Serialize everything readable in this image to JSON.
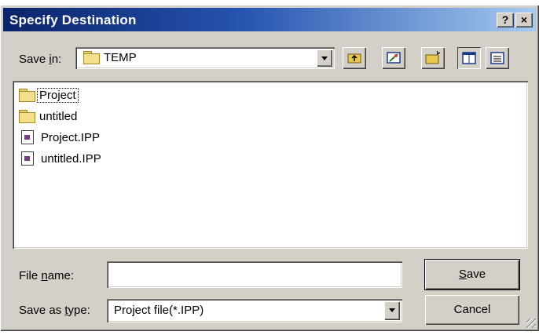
{
  "window": {
    "title": "Specify Destination",
    "help_label": "?",
    "close_label": "×"
  },
  "save_in": {
    "label_pre": "Save ",
    "label_ul": "i",
    "label_post": "n:",
    "value": "TEMP"
  },
  "toolbar": {
    "icons": [
      "up-folder-icon",
      "desktop-icon",
      "new-folder-icon",
      "list-view-icon",
      "details-view-icon"
    ]
  },
  "files": [
    {
      "name": "Project",
      "type": "folder"
    },
    {
      "name": "untitled",
      "type": "folder"
    },
    {
      "name": "Project.IPP",
      "type": "file"
    },
    {
      "name": "untitled.IPP",
      "type": "file"
    }
  ],
  "file_name": {
    "label_pre": "File ",
    "label_ul": "n",
    "label_post": "ame:",
    "value": ""
  },
  "save_as": {
    "label_pre": "Save as ",
    "label_ul": "t",
    "label_post": "ype:",
    "value": "Project file(*.IPP)"
  },
  "buttons": {
    "save_ul": "S",
    "save_rest": "ave",
    "cancel": "Cancel"
  },
  "colors": {
    "face": "#d4d0c8",
    "title_start": "#0a246a",
    "title_end": "#a6caf0"
  }
}
